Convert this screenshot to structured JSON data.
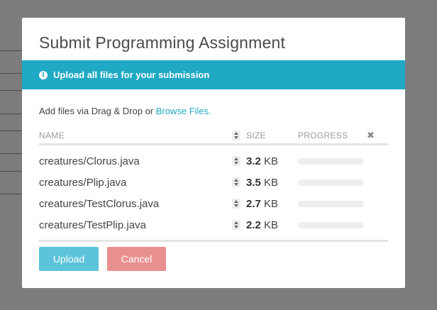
{
  "modal": {
    "title": "Submit Programming Assignment",
    "banner_text": "Upload all files for your submission",
    "banner_icon": "info-icon",
    "add_files_prefix": "Add files via Drag & Drop or ",
    "browse_link": "Browse Files."
  },
  "table": {
    "headers": {
      "name": "NAME",
      "size": "SIZE",
      "progress": "PROGRESS",
      "clear_icon": "✖"
    },
    "rows": [
      {
        "name": "creatures/Clorus.java",
        "size_value": "3.2",
        "size_unit": "KB",
        "progress": 0
      },
      {
        "name": "creatures/Plip.java",
        "size_value": "3.5",
        "size_unit": "KB",
        "progress": 0
      },
      {
        "name": "creatures/TestClorus.java",
        "size_value": "2.7",
        "size_unit": "KB",
        "progress": 0
      },
      {
        "name": "creatures/TestPlip.java",
        "size_value": "2.2",
        "size_unit": "KB",
        "progress": 0
      }
    ]
  },
  "buttons": {
    "upload": "Upload",
    "cancel": "Cancel"
  },
  "colors": {
    "accent": "#1fa9c4",
    "upload_button": "#5cc3da",
    "cancel_button": "#e8908f"
  }
}
